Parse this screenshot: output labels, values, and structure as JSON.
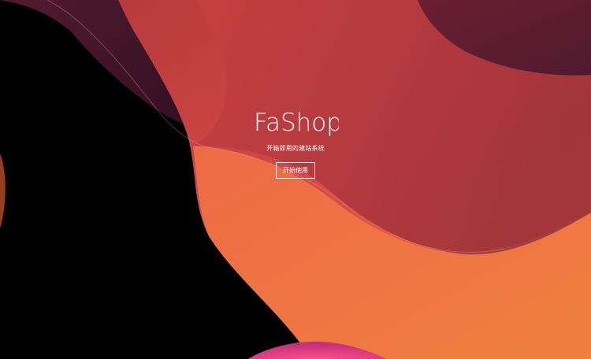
{
  "brand": {
    "logo_text": "FaShop"
  },
  "hero": {
    "tagline": "开箱即用的建站系统",
    "start_button_label": "开始使用"
  },
  "colors": {
    "background": "#000000",
    "accent_red": "#b63a3d",
    "accent_orange": "#e6613d",
    "accent_pink": "#d94b7a",
    "text": "#ffffff"
  }
}
